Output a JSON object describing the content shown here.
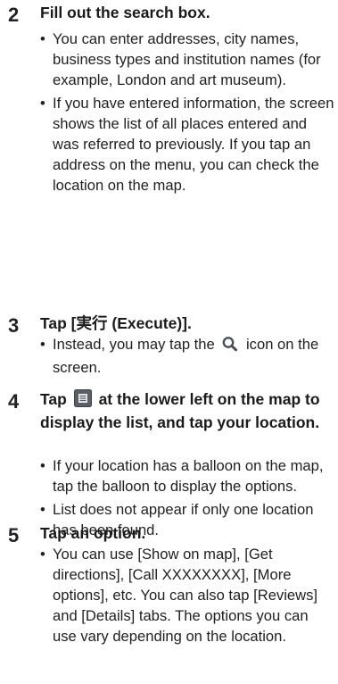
{
  "steps": [
    {
      "number": "2",
      "title": "Fill out the search box.",
      "bullets": [
        "You can enter addresses, city names, business types and institution names (for example, London and art museum).",
        "If you have entered information, the screen shows the list of all places entered and was referred to previously. If you tap an address on the menu, you can check the location on the map."
      ]
    },
    {
      "number": "3",
      "title": "Tap [実行 (Execute)].",
      "bullet_before_icon": "Instead, you may tap the",
      "bullet_icon": "search-icon",
      "bullet_after_icon": "icon on the screen."
    },
    {
      "number": "4",
      "title_before_icon": "Tap",
      "title_icon": "list-icon",
      "title_after_icon": "at the lower left on the map to display the list, and tap your location.",
      "bullets": [
        "If your location has a balloon on the map, tap the balloon to display the options.",
        "List does not appear if only one location has been found."
      ]
    },
    {
      "number": "5",
      "title": "Tap an option.",
      "bullets": [
        "You can use [Show on map], [Get directions], [Call XXXXXXXX], [More options], etc. You can also tap [Reviews] and [Details] tabs. The options you can use vary depending on the location."
      ]
    }
  ],
  "bullet_glyph": "•",
  "colors": {
    "text": "#1a1a1a",
    "icon_bg": "#5a5f66"
  }
}
